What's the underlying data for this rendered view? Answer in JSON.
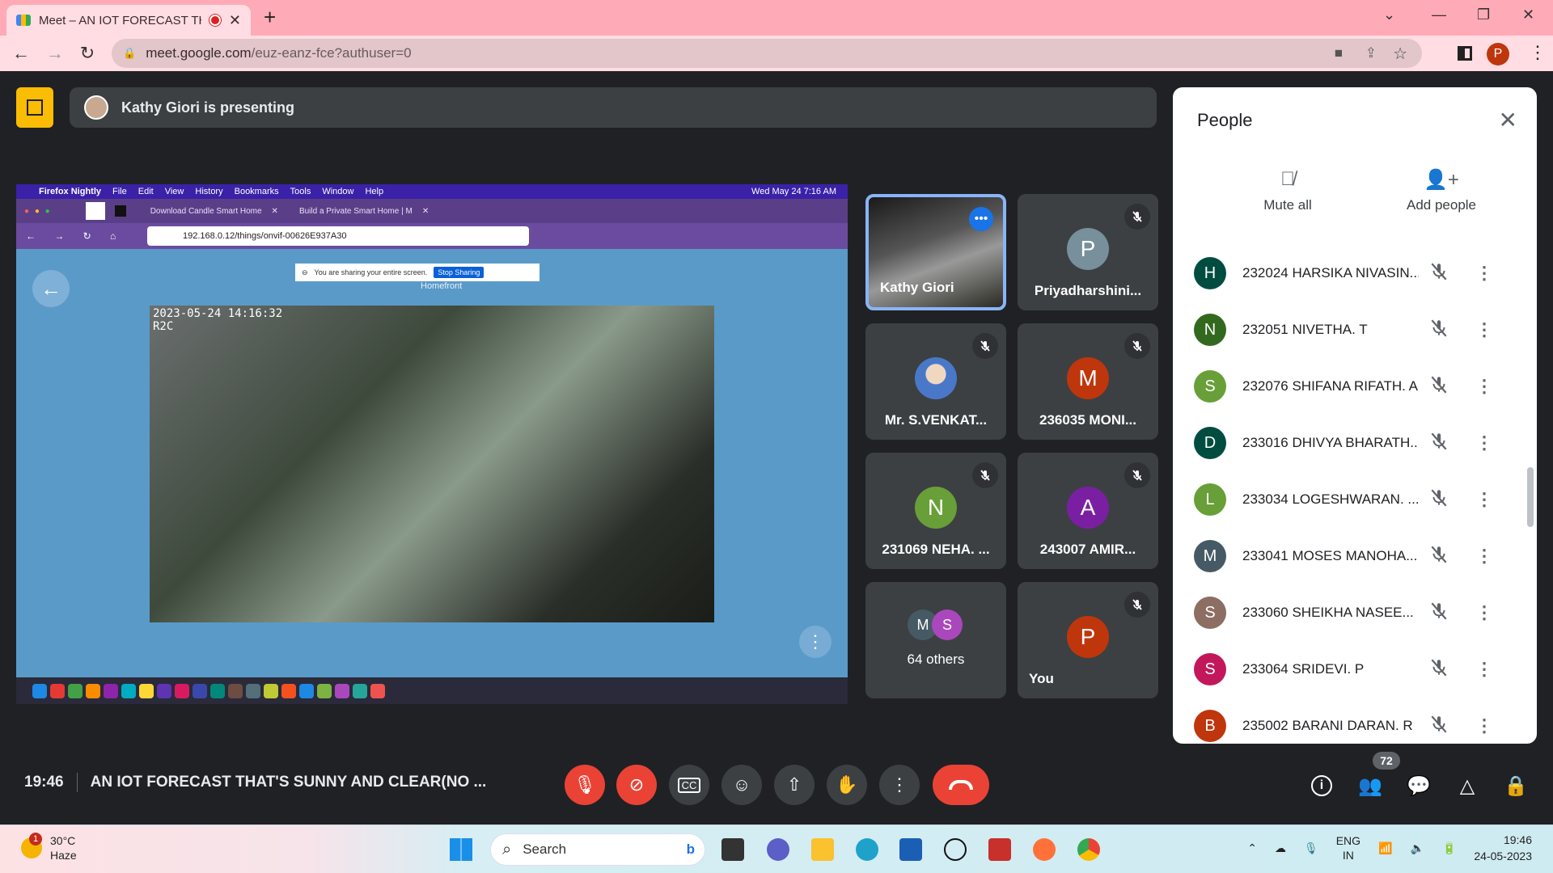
{
  "browser": {
    "tab_title": "Meet – AN IOT FORECAST TH",
    "url_domain": "meet.google.com",
    "url_path": "/euz-eanz-fce?authuser=0",
    "profile_initial": "P",
    "new_tab_label": "+"
  },
  "meet": {
    "presenting_text": "Kathy Giori is presenting",
    "time": "19:46",
    "meeting_title": "AN IOT FORECAST THAT'S SUNNY AND CLEAR(NO ...",
    "participant_count": "72"
  },
  "shared_screen": {
    "mac_menu": [
      "Firefox Nightly",
      "File",
      "Edit",
      "View",
      "History",
      "Bookmarks",
      "Tools",
      "Window",
      "Help"
    ],
    "mac_clock": "Wed May 24  7:16 AM",
    "ff_tabs": [
      "Download Candle Smart Home",
      "Build a Private Smart Home | M"
    ],
    "ff_url": "192.168.0.12/things/onvif-00626E937A30",
    "sharing_notice": "You are sharing your entire screen.",
    "stop_sharing": "Stop Sharing",
    "page_label": "Homefront",
    "cam_timestamp": "2023-05-24 14:16:32",
    "cam_label": "R2C"
  },
  "tiles": [
    {
      "name": "Kathy Giori",
      "initial": "",
      "color": "",
      "muted": false
    },
    {
      "name": "Priyadharshini...",
      "initial": "P",
      "color": "#78909c",
      "muted": true
    },
    {
      "name": "Mr. S.VENKAT...",
      "initial": "",
      "color": "#9ab0d8",
      "muted": true
    },
    {
      "name": "236035 MONI...",
      "initial": "M",
      "color": "#bf360c",
      "muted": true
    },
    {
      "name": "231069 NEHA. ...",
      "initial": "N",
      "color": "#689f38",
      "muted": true
    },
    {
      "name": "243007 AMIR...",
      "initial": "A",
      "color": "#7b1fa2",
      "muted": true
    },
    {
      "name": "64 others",
      "initials": [
        "M",
        "S"
      ],
      "colors": [
        "#455a64",
        "#ab47bc"
      ]
    },
    {
      "name": "You",
      "initial": "P",
      "color": "#bf360c",
      "muted": true
    }
  ],
  "people_panel": {
    "title": "People",
    "mute_all": "Mute all",
    "add_people": "Add people",
    "participants": [
      {
        "initial": "H",
        "name": "232024 HARSIKA NIVASIN...",
        "color": "#004d40"
      },
      {
        "initial": "N",
        "name": "232051 NIVETHA. T",
        "color": "#33691e"
      },
      {
        "initial": "S",
        "name": "232076 SHIFANA RIFATH. A",
        "color": "#689f38"
      },
      {
        "initial": "D",
        "name": "233016 DHIVYA BHARATH...",
        "color": "#004d40"
      },
      {
        "initial": "L",
        "name": "233034 LOGESHWARAN. ...",
        "color": "#689f38"
      },
      {
        "initial": "M",
        "name": "233041 MOSES MANOHA...",
        "color": "#455a64"
      },
      {
        "initial": "S",
        "name": "233060 SHEIKHA NASEE...",
        "color": "#8d6e63"
      },
      {
        "initial": "S",
        "name": "233064 SRIDEVI. P",
        "color": "#c2185b"
      },
      {
        "initial": "B",
        "name": "235002 BARANI DARAN. R",
        "color": "#bf360c"
      }
    ]
  },
  "taskbar": {
    "weather_temp": "30°C",
    "weather_desc": "Haze",
    "weather_badge": "1",
    "search_placeholder": "Search",
    "lang_top": "ENG",
    "lang_bottom": "IN",
    "clock_time": "19:46",
    "clock_date": "24-05-2023"
  }
}
